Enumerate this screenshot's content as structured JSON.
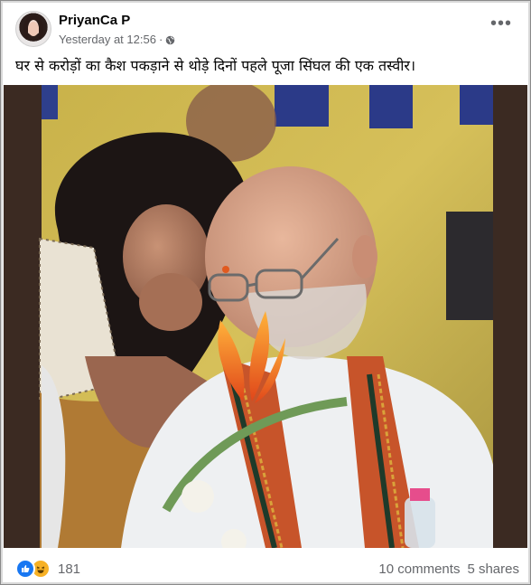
{
  "post": {
    "author": "PriyanCa P",
    "timestamp": "Yesterday at 12:56",
    "separator": "·",
    "audience_icon": "globe-icon",
    "more_icon": "more-options-icon",
    "caption": "घर से करोड़ों का कैश पकड़ाने से थोड़े दिनों पहले पूजा सिंघल की एक तस्वीर।"
  },
  "footer": {
    "reactions": [
      "like-icon",
      "haha-icon"
    ],
    "reaction_count": "181",
    "comments": "10 comments",
    "shares": "5 shares"
  },
  "colors": {
    "like": "#1877f2",
    "haha": "#f7b125",
    "meta_text": "#65676b",
    "photo_border": "#3a2b24"
  }
}
